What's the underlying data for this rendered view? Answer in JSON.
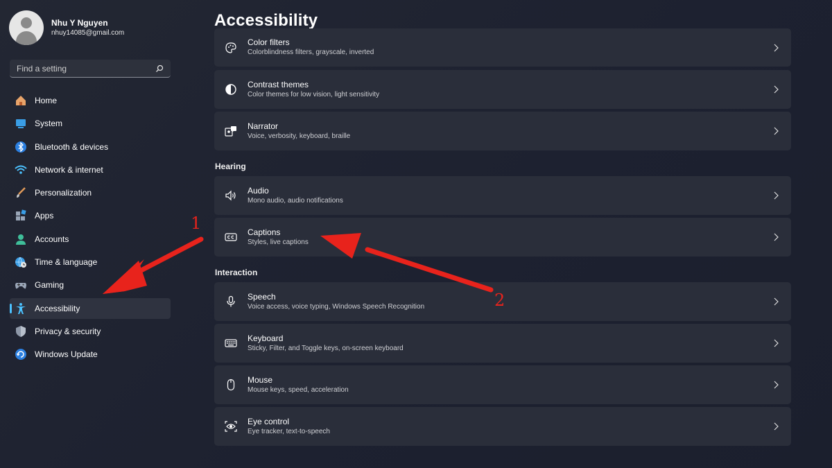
{
  "profile": {
    "name": "Nhu Y Nguyen",
    "email": "nhuy14085@gmail.com"
  },
  "search": {
    "placeholder": "Find a setting"
  },
  "sidebar": {
    "items": [
      {
        "label": "Home",
        "icon": "home-icon"
      },
      {
        "label": "System",
        "icon": "system-icon"
      },
      {
        "label": "Bluetooth & devices",
        "icon": "bluetooth-icon"
      },
      {
        "label": "Network & internet",
        "icon": "wifi-icon"
      },
      {
        "label": "Personalization",
        "icon": "brush-icon"
      },
      {
        "label": "Apps",
        "icon": "apps-icon"
      },
      {
        "label": "Accounts",
        "icon": "accounts-icon"
      },
      {
        "label": "Time & language",
        "icon": "globe-clock-icon"
      },
      {
        "label": "Gaming",
        "icon": "gamepad-icon"
      },
      {
        "label": "Accessibility",
        "icon": "accessibility-icon",
        "active": true
      },
      {
        "label": "Privacy & security",
        "icon": "shield-icon"
      },
      {
        "label": "Windows Update",
        "icon": "update-icon"
      }
    ]
  },
  "main": {
    "title": "Accessibility",
    "vision_items": [
      {
        "title": "Color filters",
        "subtitle": "Colorblindness filters, grayscale, inverted",
        "icon": "palette-icon"
      },
      {
        "title": "Contrast themes",
        "subtitle": "Color themes for low vision, light sensitivity",
        "icon": "contrast-icon"
      },
      {
        "title": "Narrator",
        "subtitle": "Voice, verbosity, keyboard, braille",
        "icon": "narrator-icon"
      }
    ],
    "hearing_label": "Hearing",
    "hearing_items": [
      {
        "title": "Audio",
        "subtitle": "Mono audio, audio notifications",
        "icon": "speaker-icon"
      },
      {
        "title": "Captions",
        "subtitle": "Styles, live captions",
        "icon": "captions-icon"
      }
    ],
    "interaction_label": "Interaction",
    "interaction_items": [
      {
        "title": "Speech",
        "subtitle": "Voice access, voice typing, Windows Speech Recognition",
        "icon": "microphone-icon"
      },
      {
        "title": "Keyboard",
        "subtitle": "Sticky, Filter, and Toggle keys, on-screen keyboard",
        "icon": "keyboard-icon"
      },
      {
        "title": "Mouse",
        "subtitle": "Mouse keys, speed, acceleration",
        "icon": "mouse-icon"
      },
      {
        "title": "Eye control",
        "subtitle": "Eye tracker, text-to-speech",
        "icon": "eye-control-icon"
      }
    ]
  },
  "annotations": {
    "label_1": "1",
    "label_2": "2",
    "color": "#e8231c"
  },
  "colors": {
    "accent": "#4cc2ff",
    "card": "#2a2e3a",
    "background": "#1f2330"
  }
}
